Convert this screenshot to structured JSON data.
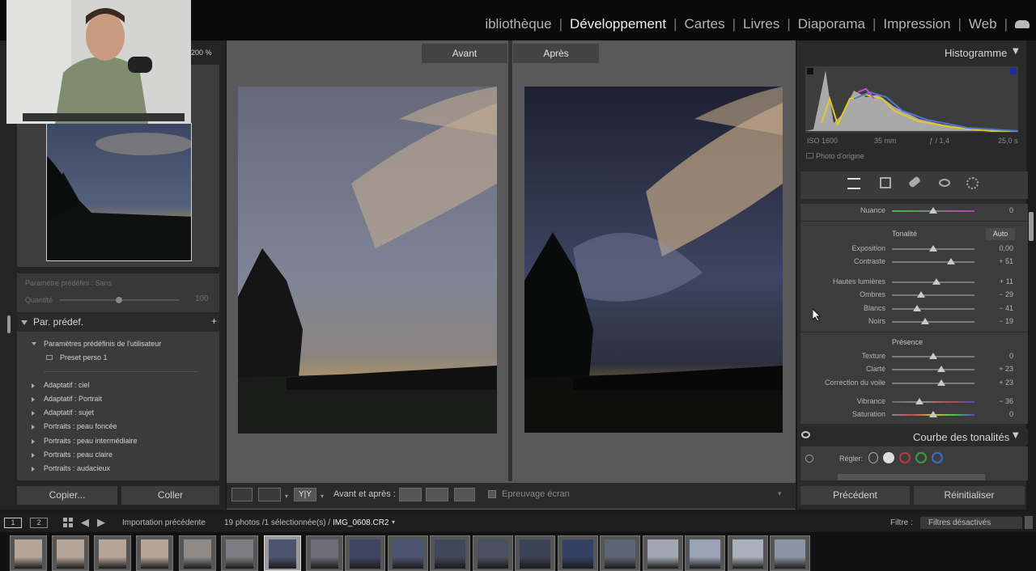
{
  "modules": {
    "items": [
      "ibliothèque",
      "Développement",
      "Cartes",
      "Livres",
      "Diaporama",
      "Impression",
      "Web"
    ],
    "active": "Développement"
  },
  "navigator": {
    "zoom": "200 %"
  },
  "preset_amount": {
    "label": "Paramètre prédéfini : Sans",
    "quantity_label": "Quantité",
    "quantity_value": "100",
    "quantity_level": 0.5
  },
  "presets_panel": {
    "title": "Par. prédef.",
    "add": "+",
    "user_group": "Paramètres prédéfinis de l'utilisateur",
    "user_preset": "Preset perso 1",
    "groups": [
      "Adaptatif : ciel",
      "Adaptatif : Portrait",
      "Adaptatif : sujet",
      "Portraits : peau foncée",
      "Portraits : peau intermédiaire",
      "Portraits : peau claire",
      "Portraits : audacieux"
    ]
  },
  "left_buttons": {
    "copy": "Copier...",
    "paste": "Coller"
  },
  "compare": {
    "before": "Avant",
    "after": "Après"
  },
  "toolbar": {
    "yy": "Y|Y",
    "before_after_label": "Avant et après :",
    "proof_label": "Epreuvage écran"
  },
  "histogram": {
    "title": "Histogramme",
    "iso": "ISO 1600",
    "focal": "35 mm",
    "aperture": "ƒ / 1,4",
    "shutter": "25,0 s",
    "original_label": "Photo d'origine"
  },
  "basic": {
    "tint": {
      "label": "Nuance",
      "value": "0",
      "pos": 0.5
    },
    "tone_title": "Tonalité",
    "auto": "Auto",
    "exposure": {
      "label": "Exposition",
      "value": "0,00",
      "pos": 0.5
    },
    "contrast": {
      "label": "Contraste",
      "value": "+ 51",
      "pos": 0.72
    },
    "highlights": {
      "label": "Hautes lumières",
      "value": "+ 11",
      "pos": 0.54
    },
    "shadows": {
      "label": "Ombres",
      "value": "− 29",
      "pos": 0.35
    },
    "whites": {
      "label": "Blancs",
      "value": "− 41",
      "pos": 0.3
    },
    "blacks": {
      "label": "Noirs",
      "value": "− 19",
      "pos": 0.4
    },
    "presence_title": "Présence",
    "texture": {
      "label": "Texture",
      "value": "0",
      "pos": 0.5
    },
    "clarity": {
      "label": "Clarté",
      "value": "+ 23",
      "pos": 0.6
    },
    "dehaze": {
      "label": "Correction du voile",
      "value": "+ 23",
      "pos": 0.6
    },
    "vibrance": {
      "label": "Vibrance",
      "value": "− 36",
      "pos": 0.33
    },
    "saturation": {
      "label": "Saturation",
      "value": "0",
      "pos": 0.5
    }
  },
  "tone_curve": {
    "title": "Courbe des tonalités",
    "adjust_label": "Régler:"
  },
  "right_buttons": {
    "previous": "Précédent",
    "reset": "Réinitialiser"
  },
  "filmbar": {
    "view1": "1",
    "view2": "2",
    "source": "Importation précédente",
    "count": "19 photos /1 sélectionnée(s) /",
    "filename": "IMG_0608.CR2",
    "filter_label": "Filtre :",
    "filter_value": "Filtres désactivés"
  },
  "colors": {
    "accent_before": "#434343",
    "panel": "#3c3c3c"
  }
}
